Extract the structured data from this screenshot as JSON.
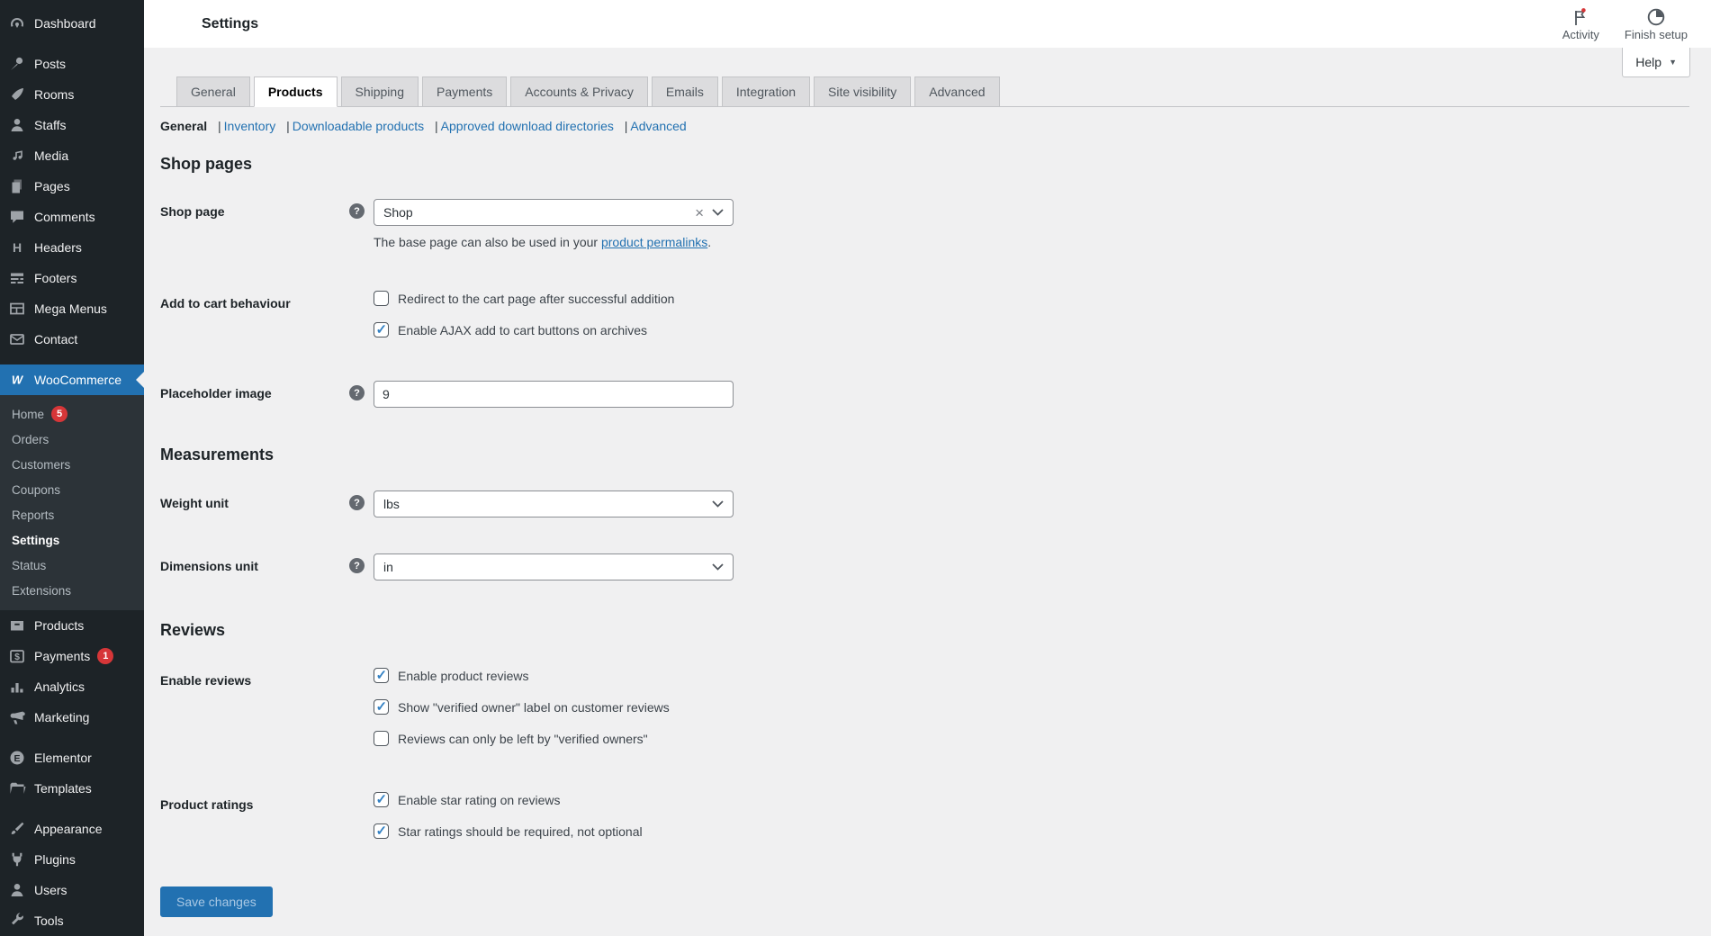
{
  "colors": {
    "accent": "#2271b1",
    "sidebar_bg": "#1d2327",
    "submenu_bg": "#2c3338",
    "content_bg": "#f0f0f1",
    "badge_red": "#d63638",
    "check_blue": "#3582c4",
    "tab_inactive_bg": "#dcdcde"
  },
  "icons": {
    "help_glyph": "?",
    "clear_glyph": "×",
    "caret_down_glyph": "▼"
  },
  "sidebar": {
    "top_items": [
      {
        "label": "Dashboard",
        "icon": "dashboard-icon"
      },
      {
        "label": "Posts",
        "icon": "pushpin-icon"
      },
      {
        "label": "Rooms",
        "icon": "carrot-icon"
      },
      {
        "label": "Staffs",
        "icon": "person-icon"
      },
      {
        "label": "Media",
        "icon": "media-icon"
      },
      {
        "label": "Pages",
        "icon": "pages-icon"
      },
      {
        "label": "Comments",
        "icon": "comment-icon"
      },
      {
        "label": "Headers",
        "icon": "letter-h-icon",
        "glyph": "H"
      },
      {
        "label": "Footers",
        "icon": "footer-lines-icon"
      },
      {
        "label": "Mega Menus",
        "icon": "grid-icon"
      },
      {
        "label": "Contact",
        "icon": "envelope-icon"
      }
    ],
    "woocommerce": {
      "label": "WooCommerce",
      "icon": "woocommerce-icon",
      "glyph": "W",
      "submenu": [
        {
          "label": "Home",
          "badge": "5"
        },
        {
          "label": "Orders"
        },
        {
          "label": "Customers"
        },
        {
          "label": "Coupons"
        },
        {
          "label": "Reports"
        },
        {
          "label": "Settings",
          "current": true
        },
        {
          "label": "Status"
        },
        {
          "label": "Extensions"
        }
      ]
    },
    "mid_items": [
      {
        "label": "Products",
        "icon": "box-icon"
      },
      {
        "label": "Payments",
        "icon": "dollar-icon",
        "glyph": "$",
        "badge": "1"
      },
      {
        "label": "Analytics",
        "icon": "bar-chart-icon"
      },
      {
        "label": "Marketing",
        "icon": "megaphone-icon"
      }
    ],
    "plugin_items": [
      {
        "label": "Elementor",
        "icon": "elementor-icon",
        "glyph": "E"
      },
      {
        "label": "Templates",
        "icon": "folder-icon"
      }
    ],
    "bottom_items": [
      {
        "label": "Appearance",
        "icon": "brush-icon"
      },
      {
        "label": "Plugins",
        "icon": "plug-icon"
      },
      {
        "label": "Users",
        "icon": "person-icon"
      },
      {
        "label": "Tools",
        "icon": "wrench-icon"
      }
    ]
  },
  "header": {
    "title": "Settings",
    "activity": "Activity",
    "finish_setup": "Finish setup",
    "help": "Help"
  },
  "tabs": {
    "items": [
      {
        "label": "General"
      },
      {
        "label": "Products",
        "active": true
      },
      {
        "label": "Shipping"
      },
      {
        "label": "Payments"
      },
      {
        "label": "Accounts & Privacy"
      },
      {
        "label": "Emails"
      },
      {
        "label": "Integration"
      },
      {
        "label": "Site visibility"
      },
      {
        "label": "Advanced"
      }
    ]
  },
  "subnav": {
    "separator": "|",
    "items": [
      {
        "label": "General",
        "current": true
      },
      {
        "label": "Inventory"
      },
      {
        "label": "Downloadable products"
      },
      {
        "label": "Approved download directories"
      },
      {
        "label": "Advanced"
      }
    ]
  },
  "form": {
    "shop_pages_heading": "Shop pages",
    "measurements_heading": "Measurements",
    "reviews_heading": "Reviews",
    "shop_page": {
      "label": "Shop page",
      "value": "Shop",
      "description_prefix": "The base page can also be used in your ",
      "description_link": "product permalinks",
      "description_suffix": "."
    },
    "add_to_cart": {
      "label": "Add to cart behaviour",
      "options": [
        {
          "label": "Redirect to the cart page after successful addition",
          "checked": false
        },
        {
          "label": "Enable AJAX add to cart buttons on archives",
          "checked": true
        }
      ]
    },
    "placeholder_image": {
      "label": "Placeholder image",
      "value": "9"
    },
    "weight_unit": {
      "label": "Weight unit",
      "value": "lbs"
    },
    "dimensions_unit": {
      "label": "Dimensions unit",
      "value": "in"
    },
    "enable_reviews": {
      "label": "Enable reviews",
      "options": [
        {
          "label": "Enable product reviews",
          "checked": true
        },
        {
          "label": "Show \"verified owner\" label on customer reviews",
          "checked": true
        },
        {
          "label": "Reviews can only be left by \"verified owners\"",
          "checked": false
        }
      ]
    },
    "product_ratings": {
      "label": "Product ratings",
      "options": [
        {
          "label": "Enable star rating on reviews",
          "checked": true
        },
        {
          "label": "Star ratings should be required, not optional",
          "checked": true
        }
      ]
    },
    "save_button": "Save changes"
  }
}
